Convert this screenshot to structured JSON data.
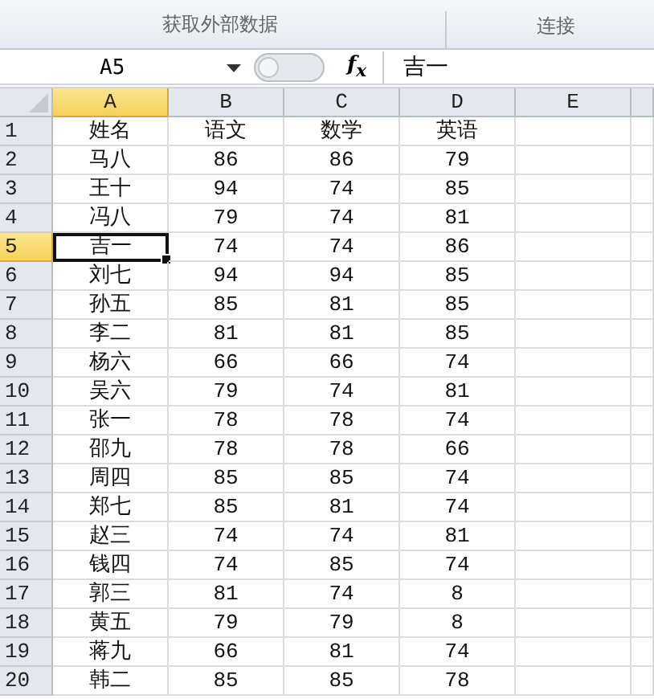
{
  "ribbon": {
    "groups": [
      {
        "label": "获取外部数据"
      },
      {
        "label": "连接"
      }
    ]
  },
  "formula_bar": {
    "name_box": "A5",
    "fx": "f$_{x}$",
    "value": "吉一"
  },
  "sheet": {
    "columns": [
      {
        "label": "A",
        "selected": true
      },
      {
        "label": "B",
        "selected": false
      },
      {
        "label": "C",
        "selected": false
      },
      {
        "label": "D",
        "selected": false
      },
      {
        "label": "E",
        "selected": false
      }
    ],
    "rows": [
      {
        "number": "1",
        "selected": false,
        "cells": [
          {
            "text": "姓名",
            "selected": false
          },
          {
            "text": "语文",
            "selected": false
          },
          {
            "text": "数学",
            "selected": false
          },
          {
            "text": "英语",
            "selected": false
          }
        ]
      },
      {
        "number": "2",
        "selected": false,
        "cells": [
          {
            "text": "马八",
            "selected": false
          },
          {
            "text": "86",
            "selected": false
          },
          {
            "text": "86",
            "selected": false
          },
          {
            "text": "79",
            "selected": false
          }
        ]
      },
      {
        "number": "3",
        "selected": false,
        "cells": [
          {
            "text": "王十",
            "selected": false
          },
          {
            "text": "94",
            "selected": false
          },
          {
            "text": "74",
            "selected": false
          },
          {
            "text": "85",
            "selected": false
          }
        ]
      },
      {
        "number": "4",
        "selected": false,
        "cells": [
          {
            "text": "冯八",
            "selected": false
          },
          {
            "text": "79",
            "selected": false
          },
          {
            "text": "74",
            "selected": false
          },
          {
            "text": "81",
            "selected": false
          }
        ]
      },
      {
        "number": "5",
        "selected": true,
        "cells": [
          {
            "text": "吉一",
            "selected": true
          },
          {
            "text": "74",
            "selected": false
          },
          {
            "text": "74",
            "selected": false
          },
          {
            "text": "86",
            "selected": false
          }
        ]
      },
      {
        "number": "6",
        "selected": false,
        "cells": [
          {
            "text": "刘七",
            "selected": false
          },
          {
            "text": "94",
            "selected": false
          },
          {
            "text": "94",
            "selected": false
          },
          {
            "text": "85",
            "selected": false
          }
        ]
      },
      {
        "number": "7",
        "selected": false,
        "cells": [
          {
            "text": "孙五",
            "selected": false
          },
          {
            "text": "85",
            "selected": false
          },
          {
            "text": "81",
            "selected": false
          },
          {
            "text": "85",
            "selected": false
          }
        ]
      },
      {
        "number": "8",
        "selected": false,
        "cells": [
          {
            "text": "李二",
            "selected": false
          },
          {
            "text": "81",
            "selected": false
          },
          {
            "text": "81",
            "selected": false
          },
          {
            "text": "85",
            "selected": false
          }
        ]
      },
      {
        "number": "9",
        "selected": false,
        "cells": [
          {
            "text": "杨六",
            "selected": false
          },
          {
            "text": "66",
            "selected": false
          },
          {
            "text": "66",
            "selected": false
          },
          {
            "text": "74",
            "selected": false
          }
        ]
      },
      {
        "number": "10",
        "selected": false,
        "cells": [
          {
            "text": "吴六",
            "selected": false
          },
          {
            "text": "79",
            "selected": false
          },
          {
            "text": "74",
            "selected": false
          },
          {
            "text": "81",
            "selected": false
          }
        ]
      },
      {
        "number": "11",
        "selected": false,
        "cells": [
          {
            "text": "张一",
            "selected": false
          },
          {
            "text": "78",
            "selected": false
          },
          {
            "text": "78",
            "selected": false
          },
          {
            "text": "74",
            "selected": false
          }
        ]
      },
      {
        "number": "12",
        "selected": false,
        "cells": [
          {
            "text": "邵九",
            "selected": false
          },
          {
            "text": "78",
            "selected": false
          },
          {
            "text": "78",
            "selected": false
          },
          {
            "text": "66",
            "selected": false
          }
        ]
      },
      {
        "number": "13",
        "selected": false,
        "cells": [
          {
            "text": "周四",
            "selected": false
          },
          {
            "text": "85",
            "selected": false
          },
          {
            "text": "85",
            "selected": false
          },
          {
            "text": "74",
            "selected": false
          }
        ]
      },
      {
        "number": "14",
        "selected": false,
        "cells": [
          {
            "text": "郑七",
            "selected": false
          },
          {
            "text": "85",
            "selected": false
          },
          {
            "text": "81",
            "selected": false
          },
          {
            "text": "74",
            "selected": false
          }
        ]
      },
      {
        "number": "15",
        "selected": false,
        "cells": [
          {
            "text": "赵三",
            "selected": false
          },
          {
            "text": "74",
            "selected": false
          },
          {
            "text": "74",
            "selected": false
          },
          {
            "text": "81",
            "selected": false
          }
        ]
      },
      {
        "number": "16",
        "selected": false,
        "cells": [
          {
            "text": "钱四",
            "selected": false
          },
          {
            "text": "74",
            "selected": false
          },
          {
            "text": "85",
            "selected": false
          },
          {
            "text": "74",
            "selected": false
          }
        ]
      },
      {
        "number": "17",
        "selected": false,
        "cells": [
          {
            "text": "郭三",
            "selected": false
          },
          {
            "text": "81",
            "selected": false
          },
          {
            "text": "74",
            "selected": false
          },
          {
            "text": "8",
            "selected": false
          }
        ]
      },
      {
        "number": "18",
        "selected": false,
        "cells": [
          {
            "text": "黄五",
            "selected": false
          },
          {
            "text": "79",
            "selected": false
          },
          {
            "text": "79",
            "selected": false
          },
          {
            "text": "8",
            "selected": false
          }
        ]
      },
      {
        "number": "19",
        "selected": false,
        "cells": [
          {
            "text": "蒋九",
            "selected": false
          },
          {
            "text": "66",
            "selected": false
          },
          {
            "text": "81",
            "selected": false
          },
          {
            "text": "74",
            "selected": false
          }
        ]
      },
      {
        "number": "20",
        "selected": false,
        "cells": [
          {
            "text": "韩二",
            "selected": false
          },
          {
            "text": "85",
            "selected": false
          },
          {
            "text": "85",
            "selected": false
          },
          {
            "text": "78",
            "selected": false
          }
        ]
      }
    ]
  }
}
